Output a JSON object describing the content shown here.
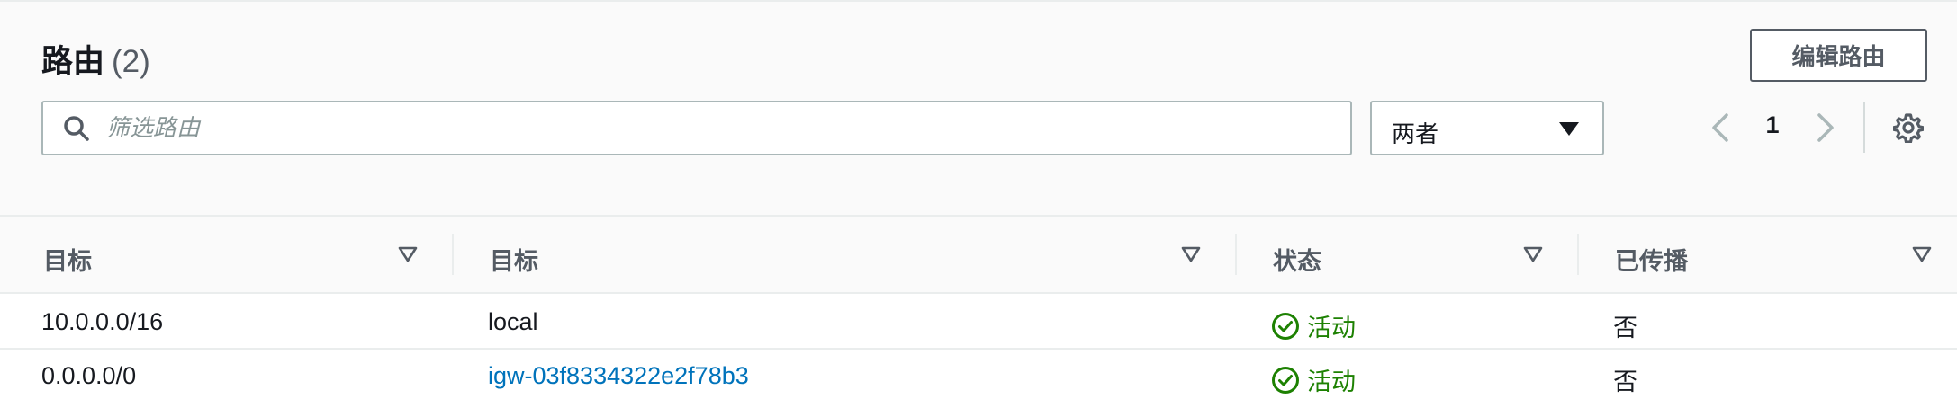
{
  "header": {
    "title": "路由",
    "count": "(2)",
    "edit_button": "编辑路由"
  },
  "filter": {
    "search_placeholder": "筛选路由",
    "search_value": "",
    "select_value": "两者"
  },
  "pagination": {
    "current_page": "1"
  },
  "table": {
    "columns": [
      "目标",
      "目标",
      "状态",
      "已传播"
    ],
    "rows": [
      {
        "destination": "10.0.0.0/16",
        "target": "local",
        "target_is_link": false,
        "status": "活动",
        "propagated": "否"
      },
      {
        "destination": "0.0.0.0/0",
        "target": "igw-03f8334322e2f78b3",
        "target_is_link": true,
        "status": "活动",
        "propagated": "否"
      }
    ]
  },
  "colors": {
    "status_active": "#1d8102",
    "link": "#0073bb",
    "header_bg": "#fafafa"
  },
  "icons": {
    "search": "search-icon",
    "select_caret": "caret-down-icon",
    "prev": "chevron-left-icon",
    "next": "chevron-right-icon",
    "settings": "gear-icon",
    "sort": "sort-down-icon",
    "status": "check-circle-icon"
  }
}
